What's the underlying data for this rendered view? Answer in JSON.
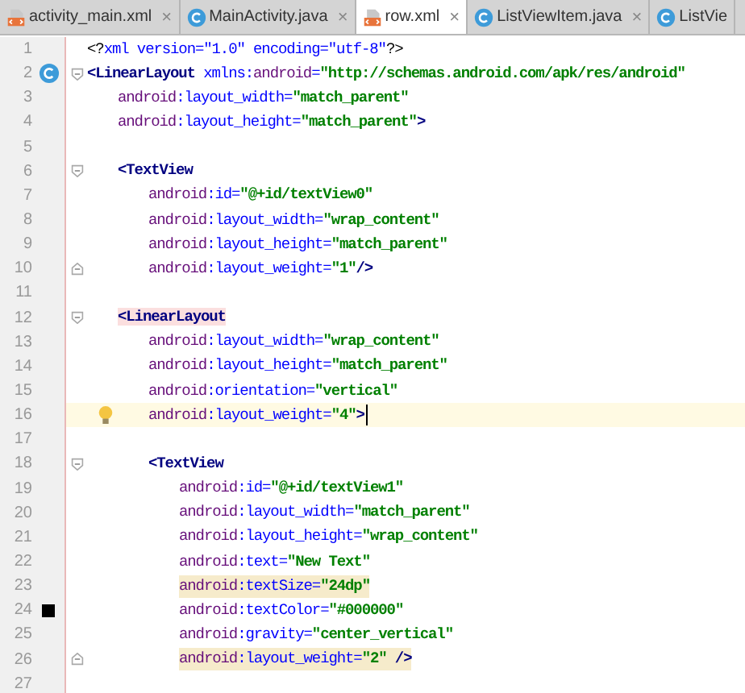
{
  "tabs": [
    {
      "label": "activity_main.xml",
      "kind": "xml",
      "selected": false,
      "closable": true
    },
    {
      "label": "MainActivity.java",
      "kind": "class",
      "selected": false,
      "closable": true
    },
    {
      "label": "row.xml",
      "kind": "xml",
      "selected": true,
      "closable": true
    },
    {
      "label": "ListViewItem.java",
      "kind": "class",
      "selected": false,
      "closable": true
    },
    {
      "label": "ListVie",
      "kind": "class",
      "selected": false,
      "closable": false
    }
  ],
  "close_glyph": "×",
  "lines": [
    {
      "number": "1",
      "fold_start": false,
      "fold_end": false,
      "current": false,
      "warning": false,
      "matched": false,
      "segments": [
        {
          "kind": "punct",
          "text": "<?"
        },
        {
          "kind": "attr",
          "text": "xml version=\"1.0\" encoding=\"utf-8\""
        },
        {
          "kind": "punct",
          "text": "?>"
        }
      ]
    },
    {
      "number": "2",
      "kind": "class",
      "fold_start": true,
      "fold_end": false,
      "current": false,
      "warning": false,
      "matched": false,
      "segments": [
        {
          "kind": "tag",
          "text": "<LinearLayout "
        },
        {
          "kind": "attr",
          "text": "xmlns:"
        },
        {
          "kind": "ns",
          "text": "android"
        },
        {
          "kind": "attr",
          "text": "="
        },
        {
          "kind": "value",
          "text": "\"http://schemas.android.com/apk/res/android\""
        }
      ],
      "children": [
        {
          "number": "3",
          "fold_start": false,
          "fold_end": false,
          "current": false,
          "warning": false,
          "matched": false,
          "segments": [
            {
              "kind": "ns",
              "text": "android"
            },
            {
              "kind": "attr",
              "text": ":layout_width="
            },
            {
              "kind": "value",
              "text": "\"match_parent\""
            }
          ]
        },
        {
          "number": "4",
          "fold_start": false,
          "fold_end": false,
          "current": false,
          "warning": false,
          "matched": false,
          "segments": [
            {
              "kind": "ns",
              "text": "android"
            },
            {
              "kind": "attr",
              "text": ":layout_height="
            },
            {
              "kind": "value",
              "text": "\"match_parent\""
            },
            {
              "kind": "tag",
              "text": ">"
            }
          ]
        },
        {
          "number": "5",
          "fold_start": false,
          "fold_end": false,
          "current": false,
          "warning": false,
          "matched": false
        },
        {
          "number": "6",
          "fold_start": true,
          "fold_end": false,
          "current": false,
          "warning": false,
          "matched": false,
          "segments": [
            {
              "kind": "tag",
              "text": "<TextView"
            }
          ],
          "children": [
            {
              "number": "7",
              "fold_start": false,
              "fold_end": false,
              "current": false,
              "warning": false,
              "matched": false,
              "segments": [
                {
                  "kind": "ns",
                  "text": "android"
                },
                {
                  "kind": "attr",
                  "text": ":id="
                },
                {
                  "kind": "value",
                  "text": "\"@+id/textView0\""
                }
              ]
            },
            {
              "number": "8",
              "fold_start": false,
              "fold_end": false,
              "current": false,
              "warning": false,
              "matched": false,
              "segments": [
                {
                  "kind": "ns",
                  "text": "android"
                },
                {
                  "kind": "attr",
                  "text": ":layout_width="
                },
                {
                  "kind": "value",
                  "text": "\"wrap_content\""
                }
              ]
            },
            {
              "number": "9",
              "fold_start": false,
              "fold_end": false,
              "current": false,
              "warning": false,
              "matched": false,
              "segments": [
                {
                  "kind": "ns",
                  "text": "android"
                },
                {
                  "kind": "attr",
                  "text": ":layout_height="
                },
                {
                  "kind": "value",
                  "text": "\"match_parent\""
                }
              ]
            },
            {
              "number": "10",
              "fold_start": false,
              "fold_end": true,
              "current": false,
              "warning": false,
              "matched": false,
              "segments": [
                {
                  "kind": "ns",
                  "text": "android"
                },
                {
                  "kind": "attr",
                  "text": ":layout_weight="
                },
                {
                  "kind": "value",
                  "text": "\"1\""
                },
                {
                  "kind": "tag",
                  "text": "/>"
                }
              ]
            }
          ]
        },
        {
          "number": "11",
          "fold_start": false,
          "fold_end": false,
          "current": false,
          "warning": false,
          "matched": false
        },
        {
          "number": "12",
          "fold_start": true,
          "fold_end": false,
          "current": false,
          "warning": false,
          "matched": true,
          "segments": [
            {
              "kind": "tag",
              "text": "<LinearLayout"
            }
          ],
          "children": [
            {
              "number": "13",
              "fold_start": false,
              "fold_end": false,
              "current": false,
              "warning": false,
              "matched": false,
              "segments": [
                {
                  "kind": "ns",
                  "text": "android"
                },
                {
                  "kind": "attr",
                  "text": ":layout_width="
                },
                {
                  "kind": "value",
                  "text": "\"wrap_content\""
                }
              ]
            },
            {
              "number": "14",
              "fold_start": false,
              "fold_end": false,
              "current": false,
              "warning": false,
              "matched": false,
              "segments": [
                {
                  "kind": "ns",
                  "text": "android"
                },
                {
                  "kind": "attr",
                  "text": ":layout_height="
                },
                {
                  "kind": "value",
                  "text": "\"match_parent\""
                }
              ]
            },
            {
              "number": "15",
              "fold_start": false,
              "fold_end": false,
              "current": false,
              "warning": false,
              "matched": false,
              "segments": [
                {
                  "kind": "ns",
                  "text": "android"
                },
                {
                  "kind": "attr",
                  "text": ":orientation="
                },
                {
                  "kind": "value",
                  "text": "\"vertical\""
                }
              ]
            },
            {
              "number": "16",
              "kind": "bulb",
              "fold_start": false,
              "fold_end": false,
              "current": true,
              "warning": false,
              "matched": false,
              "segments": [
                {
                  "kind": "ns",
                  "text": "android"
                },
                {
                  "kind": "attr",
                  "text": ":layout_weight="
                },
                {
                  "kind": "value",
                  "text": "\"4\""
                },
                {
                  "kind": "tag",
                  "text": ">"
                }
              ]
            },
            {
              "number": "17",
              "fold_start": false,
              "fold_end": false,
              "current": false,
              "warning": false,
              "matched": false
            },
            {
              "number": "18",
              "fold_start": true,
              "fold_end": false,
              "current": false,
              "warning": false,
              "matched": false,
              "segments": [
                {
                  "kind": "tag",
                  "text": "<TextView"
                }
              ],
              "children": [
                {
                  "number": "19",
                  "fold_start": false,
                  "fold_end": false,
                  "current": false,
                  "warning": false,
                  "matched": false,
                  "segments": [
                    {
                      "kind": "ns",
                      "text": "android"
                    },
                    {
                      "kind": "attr",
                      "text": ":id="
                    },
                    {
                      "kind": "value",
                      "text": "\"@+id/textView1\""
                    }
                  ]
                },
                {
                  "number": "20",
                  "fold_start": false,
                  "fold_end": false,
                  "current": false,
                  "warning": false,
                  "matched": false,
                  "segments": [
                    {
                      "kind": "ns",
                      "text": "android"
                    },
                    {
                      "kind": "attr",
                      "text": ":layout_width="
                    },
                    {
                      "kind": "value",
                      "text": "\"match_parent\""
                    }
                  ]
                },
                {
                  "number": "21",
                  "fold_start": false,
                  "fold_end": false,
                  "current": false,
                  "warning": false,
                  "matched": false,
                  "segments": [
                    {
                      "kind": "ns",
                      "text": "android"
                    },
                    {
                      "kind": "attr",
                      "text": ":layout_height="
                    },
                    {
                      "kind": "value",
                      "text": "\"wrap_content\""
                    }
                  ]
                },
                {
                  "number": "22",
                  "fold_start": false,
                  "fold_end": false,
                  "current": false,
                  "warning": false,
                  "matched": false,
                  "segments": [
                    {
                      "kind": "ns",
                      "text": "android"
                    },
                    {
                      "kind": "attr",
                      "text": ":text="
                    },
                    {
                      "kind": "value",
                      "text": "\"New Text\""
                    }
                  ]
                },
                {
                  "number": "23",
                  "fold_start": false,
                  "fold_end": false,
                  "current": false,
                  "warning": true,
                  "matched": false,
                  "segments": [
                    {
                      "kind": "ns",
                      "text": "android"
                    },
                    {
                      "kind": "attr",
                      "text": ":textSize="
                    },
                    {
                      "kind": "value",
                      "text": "\"24dp\""
                    }
                  ]
                },
                {
                  "number": "24",
                  "kind": "swatch",
                  "color": "#000000",
                  "fold_start": false,
                  "fold_end": false,
                  "current": false,
                  "warning": false,
                  "matched": false,
                  "segments": [
                    {
                      "kind": "ns",
                      "text": "android"
                    },
                    {
                      "kind": "attr",
                      "text": ":textColor="
                    },
                    {
                      "kind": "value",
                      "text": "\"#000000\""
                    }
                  ]
                },
                {
                  "number": "25",
                  "fold_start": false,
                  "fold_end": false,
                  "current": false,
                  "warning": false,
                  "matched": false,
                  "segments": [
                    {
                      "kind": "ns",
                      "text": "android"
                    },
                    {
                      "kind": "attr",
                      "text": ":gravity="
                    },
                    {
                      "kind": "value",
                      "text": "\"center_vertical\""
                    }
                  ]
                },
                {
                  "number": "26",
                  "fold_start": false,
                  "fold_end": true,
                  "current": false,
                  "warning": true,
                  "matched": false,
                  "segments": [
                    {
                      "kind": "ns",
                      "text": "android"
                    },
                    {
                      "kind": "attr",
                      "text": ":layout_weight="
                    },
                    {
                      "kind": "value",
                      "text": "\"2\""
                    },
                    {
                      "kind": "tag",
                      "text": " />"
                    }
                  ]
                }
              ]
            }
          ]
        }
      ]
    },
    {
      "number": "27",
      "fold_start": false,
      "fold_end": false,
      "current": false,
      "warning": false,
      "matched": false
    }
  ]
}
